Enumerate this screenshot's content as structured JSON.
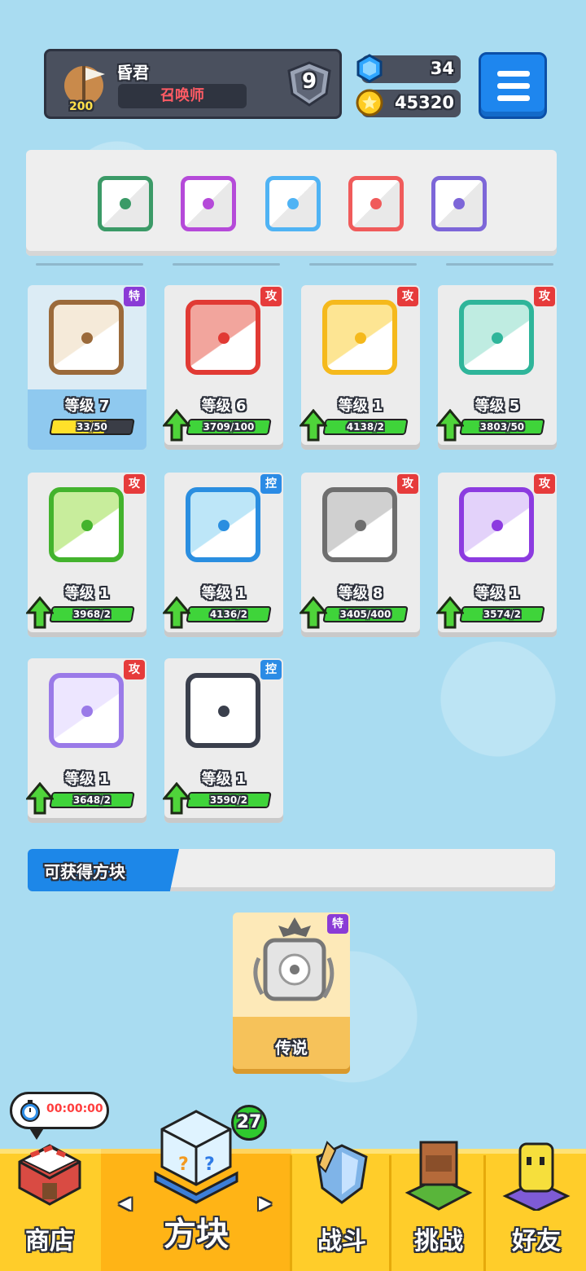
{
  "profile": {
    "name": "昏君",
    "title": "召唤师",
    "trophies": "200",
    "rank": "9"
  },
  "resources": {
    "gems": "34",
    "coins": "45320"
  },
  "deck": [
    {
      "color": "#3b9a67",
      "icon": "pentagram-dice-icon"
    },
    {
      "color": "#b54ad9",
      "icon": "combo-dice-icon"
    },
    {
      "color": "#4fb3f4",
      "icon": "infinity-dice-icon"
    },
    {
      "color": "#f05b5b",
      "icon": "rainbow-dice-icon"
    },
    {
      "color": "#7d66d8",
      "icon": "hands-dice-icon"
    }
  ],
  "cards": [
    {
      "level": "等级 7",
      "tag": "特",
      "tag_color": "#8a3bd6",
      "progress": "33/50",
      "progress_fraction": 0.66,
      "color": "#9b6a3a",
      "face_bg": "#f5ead9",
      "upgradable": false,
      "icon": "question-dice-icon"
    },
    {
      "level": "等级 6",
      "tag": "攻",
      "tag_color": "#e63b3b",
      "progress": "3709/100",
      "progress_fraction": 1,
      "color": "#e13a34",
      "face_bg": "#f2a59d",
      "upgradable": true,
      "icon": "fire-dice-icon"
    },
    {
      "level": "等级 1",
      "tag": "攻",
      "tag_color": "#e63b3b",
      "progress": "4138/2",
      "progress_fraction": 1,
      "color": "#f5b91c",
      "face_bg": "#fde593",
      "upgradable": true,
      "icon": "electric-dice-icon"
    },
    {
      "level": "等级 5",
      "tag": "攻",
      "tag_color": "#e63b3b",
      "progress": "3803/50",
      "progress_fraction": 1,
      "color": "#2fb59a",
      "face_bg": "#bfece1",
      "upgradable": true,
      "icon": "wind-dice-icon"
    },
    {
      "level": "等级 1",
      "tag": "攻",
      "tag_color": "#e63b3b",
      "progress": "3968/2",
      "progress_fraction": 1,
      "color": "#43b32d",
      "face_bg": "#c8ed9c",
      "upgradable": true,
      "icon": "poison-dice-icon"
    },
    {
      "level": "等级 1",
      "tag": "控",
      "tag_color": "#2b8be5",
      "progress": "4136/2",
      "progress_fraction": 1,
      "color": "#2a8ee0",
      "face_bg": "#bde6f8",
      "upgradable": true,
      "icon": "ice-dice-icon"
    },
    {
      "level": "等级 8",
      "tag": "攻",
      "tag_color": "#e63b3b",
      "progress": "3405/400",
      "progress_fraction": 1,
      "color": "#6e6e6e",
      "face_bg": "#d0d0d0",
      "upgradable": true,
      "icon": "gear-dice-icon"
    },
    {
      "level": "等级 1",
      "tag": "攻",
      "tag_color": "#e63b3b",
      "progress": "3574/2",
      "progress_fraction": 1,
      "color": "#8c3be0",
      "face_bg": "#e3d2fa",
      "upgradable": true,
      "icon": "arrows-dice-icon"
    },
    {
      "level": "等级 1",
      "tag": "攻",
      "tag_color": "#e63b3b",
      "progress": "3648/2",
      "progress_fraction": 1,
      "color": "#9a7ae8",
      "face_bg": "#ede6ff",
      "upgradable": true,
      "icon": "mystery-dice-icon"
    },
    {
      "level": "等级 1",
      "tag": "控",
      "tag_color": "#2b8be5",
      "progress": "3590/2",
      "progress_fraction": 1,
      "color": "#3a3f4c",
      "face_bg": "#ffffff",
      "upgradable": true,
      "icon": "lock-dice-icon"
    }
  ],
  "available": {
    "header": "可获得方块",
    "cards": [
      {
        "name": "传说",
        "tag": "特",
        "icon": "dragon-dice-icon"
      }
    ]
  },
  "timer": "00:00:00",
  "nav": {
    "items": [
      {
        "label": "商店",
        "icon": "shop-icon"
      },
      {
        "label": "方块",
        "icon": "dice-box-icon",
        "active": true,
        "badge": "27"
      },
      {
        "label": "战斗",
        "icon": "battle-icon"
      },
      {
        "label": "挑战",
        "icon": "challenge-icon"
      },
      {
        "label": "好友",
        "icon": "friends-icon"
      }
    ]
  }
}
